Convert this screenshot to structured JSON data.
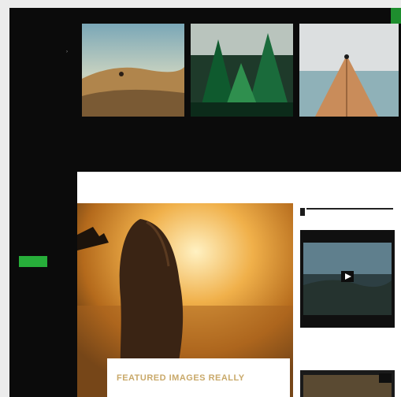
{
  "site": {
    "logo": "",
    "tagline": ""
  },
  "top_nav": {
    "items": [
      {
        "label": "",
        "active": true
      },
      {
        "label": ""
      },
      {
        "label": ""
      },
      {
        "label": ""
      },
      {
        "label": ""
      }
    ]
  },
  "sidebar": {
    "items": [
      {
        "label": ""
      },
      {
        "label": ""
      },
      {
        "label": ""
      },
      {
        "label": ""
      },
      {
        "label": ""
      },
      {
        "label": ""
      },
      {
        "label": ""
      }
    ],
    "newsletter": {
      "heading": "",
      "text": "",
      "text2": "",
      "button_label": ""
    },
    "archives": {
      "heading": "",
      "text": ""
    }
  },
  "hero_cards": [
    {
      "title": "",
      "excerpt": ""
    },
    {
      "title": "",
      "excerpt": ""
    },
    {
      "title": "",
      "excerpt": ""
    }
  ],
  "featured": {
    "meta": "",
    "title": "FEATURED IMAGES REALLY"
  },
  "right_column": {
    "heading": "",
    "caption": ""
  },
  "colors": {
    "accent": "#27ae3a",
    "dark": "#0b0b0b",
    "headline": "#c9a96a"
  },
  "icons": [
    "chevron-right-icon",
    "play-icon"
  ]
}
